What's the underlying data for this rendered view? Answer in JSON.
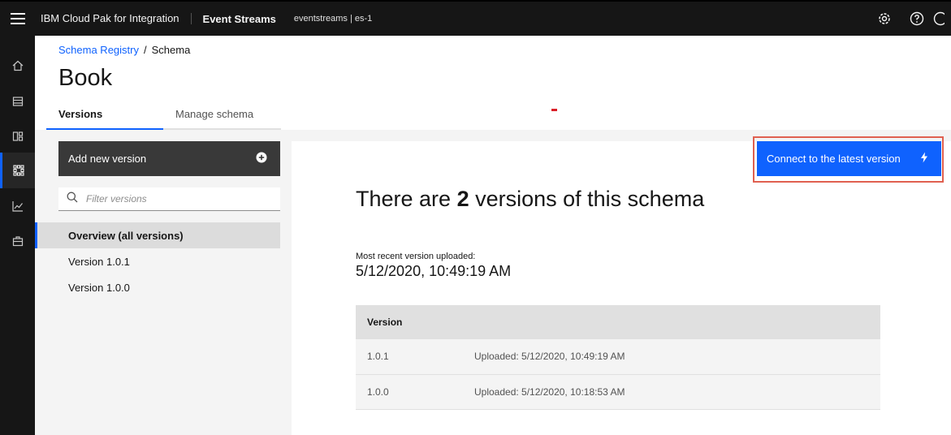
{
  "topbar": {
    "product": "IBM Cloud Pak for Integration",
    "app": "Event Streams",
    "instance": "eventstreams | es-1",
    "icons": [
      "settings-icon",
      "help-icon",
      "user-icon"
    ]
  },
  "sidenav": {
    "items": [
      {
        "icon": "home-icon",
        "active": false
      },
      {
        "icon": "topics-icon",
        "active": false
      },
      {
        "icon": "consumer-groups-icon",
        "active": false
      },
      {
        "icon": "schema-registry-icon",
        "active": true
      },
      {
        "icon": "monitoring-icon",
        "active": false
      },
      {
        "icon": "toolbox-icon",
        "active": false
      }
    ]
  },
  "breadcrumb": {
    "parent": "Schema Registry",
    "separator": "/",
    "current": "Schema"
  },
  "page": {
    "title": "Book"
  },
  "tabs": [
    {
      "label": "Versions",
      "active": true
    },
    {
      "label": "Manage schema",
      "active": false
    }
  ],
  "left": {
    "add_label": "Add new version",
    "filter_placeholder": "Filter versions",
    "versions": [
      {
        "label": "Overview (all versions)",
        "selected": true
      },
      {
        "label": "Version 1.0.1",
        "selected": false
      },
      {
        "label": "Version 1.0.0",
        "selected": false
      }
    ]
  },
  "main": {
    "connect_label": "Connect to the latest version",
    "headline_prefix": "There are ",
    "headline_count": "2",
    "headline_suffix": " versions of this schema",
    "recent_label": "Most recent version uploaded:",
    "recent_value": "5/12/2020, 10:49:19 AM",
    "table": {
      "header": "Version",
      "rows": [
        {
          "version": "1.0.1",
          "uploaded": "Uploaded: 5/12/2020, 10:49:19 AM"
        },
        {
          "version": "1.0.0",
          "uploaded": "Uploaded: 5/12/2020, 10:18:53 AM"
        }
      ]
    }
  },
  "colors": {
    "accent": "#0f62fe",
    "topbar": "#161616",
    "highlight": "#e06050"
  }
}
